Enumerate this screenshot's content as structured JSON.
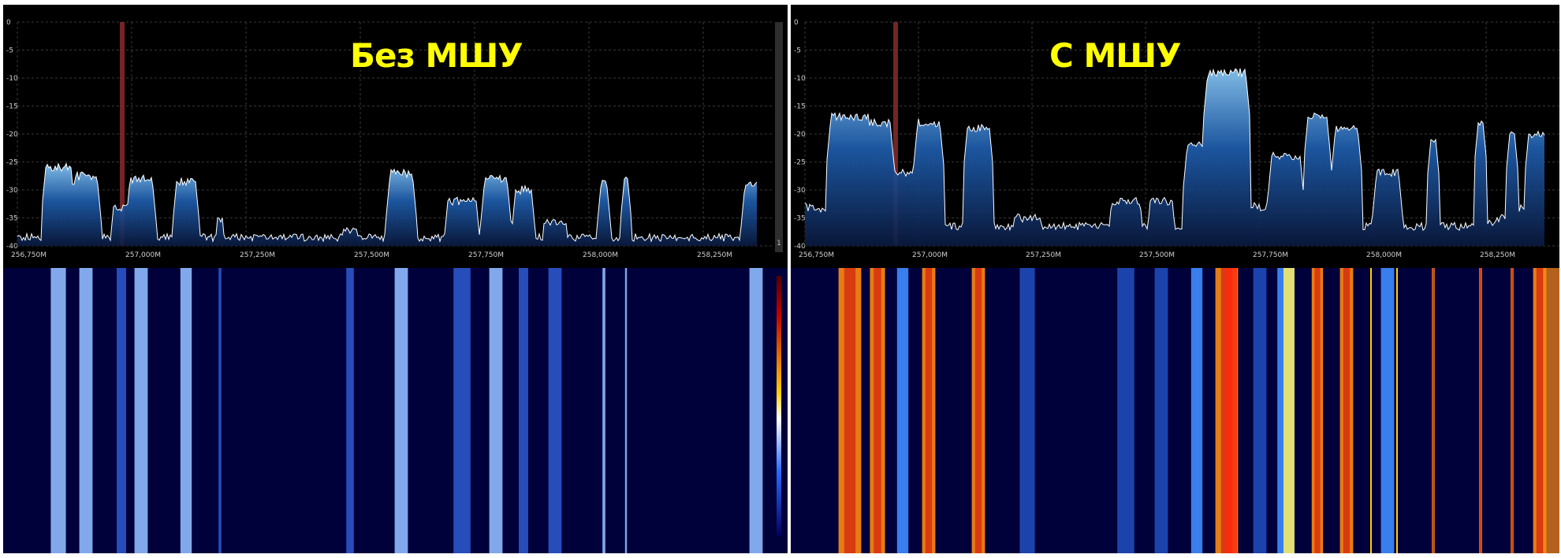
{
  "panels": [
    {
      "id": "left",
      "caption": "Без МШУ",
      "y_ticks": [
        "0",
        "-5",
        "-10",
        "-15",
        "-20",
        "-25",
        "-30",
        "-35",
        "-40"
      ],
      "x_ticks": [
        "256,750M",
        "257,000M",
        "257,250M",
        "257,500M",
        "257,750M",
        "258,000M",
        "258,250M"
      ],
      "scrollbar_button_label": "1",
      "colors": {
        "trace": "#ffffff",
        "fill": "#1f5fb0",
        "grid": "#3a3a3a",
        "marker": "#8a2a2a",
        "text": "#ffff00"
      }
    },
    {
      "id": "right",
      "caption": "С МШУ",
      "y_ticks": [
        "0",
        "-5",
        "-10",
        "-15",
        "-20",
        "-25",
        "-30",
        "-35",
        "-40"
      ],
      "x_ticks": [
        "256,750M",
        "257,000M",
        "257,250M",
        "257,500M",
        "257,750M",
        "258,000M",
        "258,250M"
      ],
      "colors": {
        "trace": "#ffffff",
        "fill": "#1f5fb0",
        "grid": "#3a3a3a",
        "marker": "#8a2a2a",
        "text": "#ffff00"
      }
    }
  ]
}
